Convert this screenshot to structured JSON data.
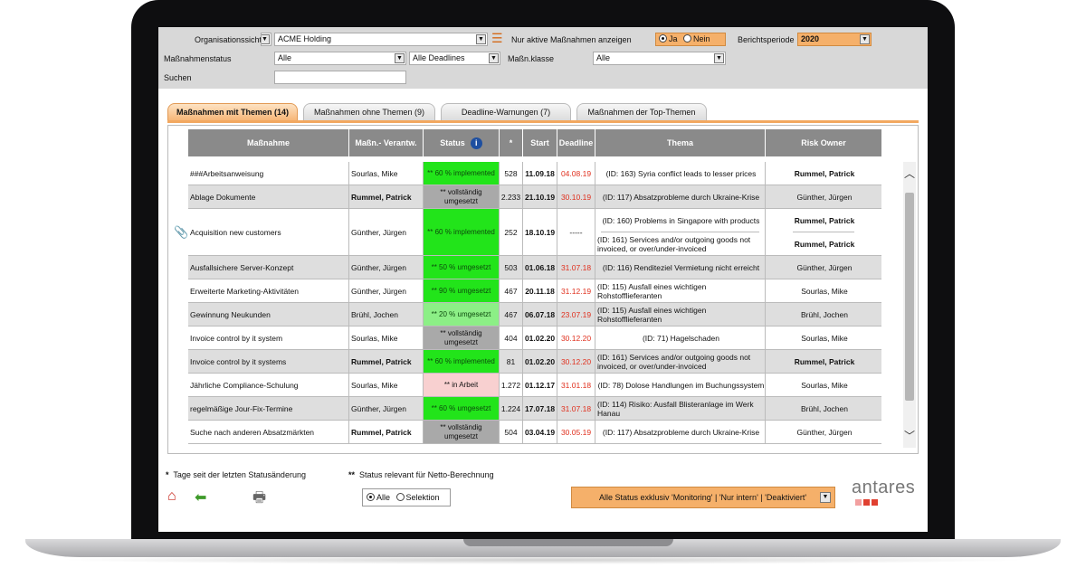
{
  "filters": {
    "org_label": "Organisationssicht",
    "org_value": "ACME Holding",
    "active_label": "Nur aktive Maßnahmen anzeigen",
    "ja": "Ja",
    "nein": "Nein",
    "period_label": "Berichtsperiode",
    "period_value": "2020",
    "status_label": "Maßnahmenstatus",
    "status_value": "Alle",
    "deadlines_value": "Alle Deadlines",
    "class_label": "Maßn.klasse",
    "class_value": "Alle",
    "search_label": "Suchen",
    "search_value": ""
  },
  "tabs": [
    {
      "label": "Maßnahmen mit Themen (14)"
    },
    {
      "label": "Maßnahmen ohne Themen (9)"
    },
    {
      "label": "Deadline-Warnungen (7)"
    },
    {
      "label": "Maßnahmen der Top-Themen"
    }
  ],
  "table": {
    "headers": [
      "Maßnahme",
      "Maßn.- Verantw.",
      "Status",
      "*",
      "Start",
      "Deadline",
      "Thema",
      "Risk Owner"
    ],
    "rows": [
      {
        "measure": "###Arbeitsanweisung",
        "resp": "Sourlas, Mike",
        "status": "** 60 % implemented",
        "days": "528",
        "start": "11.09.18",
        "deadline": "04.08.19",
        "themes": [
          {
            "t": "(ID: 163) Syria conflict leads to lesser prices",
            "o": "Rummel, Patrick"
          }
        ]
      },
      {
        "measure": "Ablage Dokumente",
        "resp": "Rummel, Patrick",
        "status": "** vollständig umgesetzt",
        "days": "2.233",
        "start": "21.10.19",
        "deadline": "30.10.19",
        "themes": [
          {
            "t": "(ID: 117) Absatzprobleme durch Ukraine-Krise",
            "o": "Günther, Jürgen"
          }
        ]
      },
      {
        "measure": "Acquisition new customers",
        "resp": "Günther, Jürgen",
        "status": "** 60 % implemented",
        "days": "252",
        "start": "18.10.19",
        "deadline": "-----",
        "themes": [
          {
            "t": "(ID: 160) Problems in Singapore with products",
            "o": "Rummel, Patrick"
          },
          {
            "t": "(ID: 161) Services and/or outgoing goods not invoiced, or over/under-invoiced",
            "o": "Rummel, Patrick"
          }
        ]
      },
      {
        "measure": "Ausfallsichere Server-Konzept",
        "resp": "Günther, Jürgen",
        "status": "** 50 % umgesetzt",
        "days": "503",
        "start": "01.06.18",
        "deadline": "31.07.18",
        "themes": [
          {
            "t": "(ID: 116) Renditeziel Vermietung nicht erreicht",
            "o": "Günther, Jürgen"
          }
        ]
      },
      {
        "measure": "Erweiterte Marketing-Aktivitäten",
        "resp": "Günther, Jürgen",
        "status": "** 90 % umgesetzt",
        "days": "467",
        "start": "20.11.18",
        "deadline": "31.12.19",
        "themes": [
          {
            "t": "(ID: 115) Ausfall eines wichtigen Rohstofflieferanten",
            "o": "Sourlas, Mike"
          }
        ]
      },
      {
        "measure": "Gewinnung Neukunden",
        "resp": "Brühl, Jochen",
        "status": "** 20 % umgesetzt",
        "days": "467",
        "start": "06.07.18",
        "deadline": "23.07.19",
        "themes": [
          {
            "t": "(ID: 115) Ausfall eines wichtigen Rohstofflieferanten",
            "o": "Brühl, Jochen"
          }
        ]
      },
      {
        "measure": "Invoice control by it system",
        "resp": "Sourlas, Mike",
        "status": "** vollständig umgesetzt",
        "days": "404",
        "start": "01.02.20",
        "deadline": "30.12.20",
        "themes": [
          {
            "t": "(ID:  71) Hagelschaden",
            "o": "Sourlas, Mike"
          }
        ]
      },
      {
        "measure": "Invoice control by it systems",
        "resp": "Rummel, Patrick",
        "status": "** 60 % implemented",
        "days": "81",
        "start": "01.02.20",
        "deadline": "30.12.20",
        "themes": [
          {
            "t": "(ID: 161) Services and/or outgoing goods not invoiced, or over/under-invoiced",
            "o": "Rummel, Patrick"
          }
        ]
      },
      {
        "measure": "Jährliche Compliance-Schulung",
        "resp": "Sourlas, Mike",
        "status": "** in Arbeit",
        "days": "1.272",
        "start": "01.12.17",
        "deadline": "31.01.18",
        "themes": [
          {
            "t": "(ID:  78) Dolose Handlungen im Buchungssystem",
            "o": "Sourlas, Mike"
          }
        ]
      },
      {
        "measure": "regelmäßige Jour-Fix-Termine",
        "resp": "Günther, Jürgen",
        "status": "** 60 % umgesetzt",
        "days": "1.224",
        "start": "17.07.18",
        "deadline": "31.07.18",
        "themes": [
          {
            "t": "(ID: 114) Risiko: Ausfall Blisteranlage im Werk Hanau",
            "o": "Brühl, Jochen"
          }
        ]
      },
      {
        "measure": "Suche nach anderen Absatzmärkten",
        "resp": "Rummel, Patrick",
        "status": "** vollständig umgesetzt",
        "days": "504",
        "start": "03.04.19",
        "deadline": "30.05.19",
        "themes": [
          {
            "t": "(ID: 117) Absatzprobleme durch Ukraine-Krise",
            "o": "Günther, Jürgen"
          }
        ]
      }
    ]
  },
  "footer": {
    "note1": "Tage seit der letzten Statusänderung",
    "note2": "Status relevant für Netto-Berechnung",
    "all": "Alle",
    "selection": "Selektion",
    "status_filter": "Alle Status exklusiv 'Monitoring' | 'Nur intern' | 'Deaktiviert'",
    "logo": "antares"
  },
  "colors": {
    "accent": "#f5b06a",
    "green": "#22e41a",
    "gray": "#a9a9a9",
    "red": "#e0301e",
    "header": "#8a8a8a"
  }
}
